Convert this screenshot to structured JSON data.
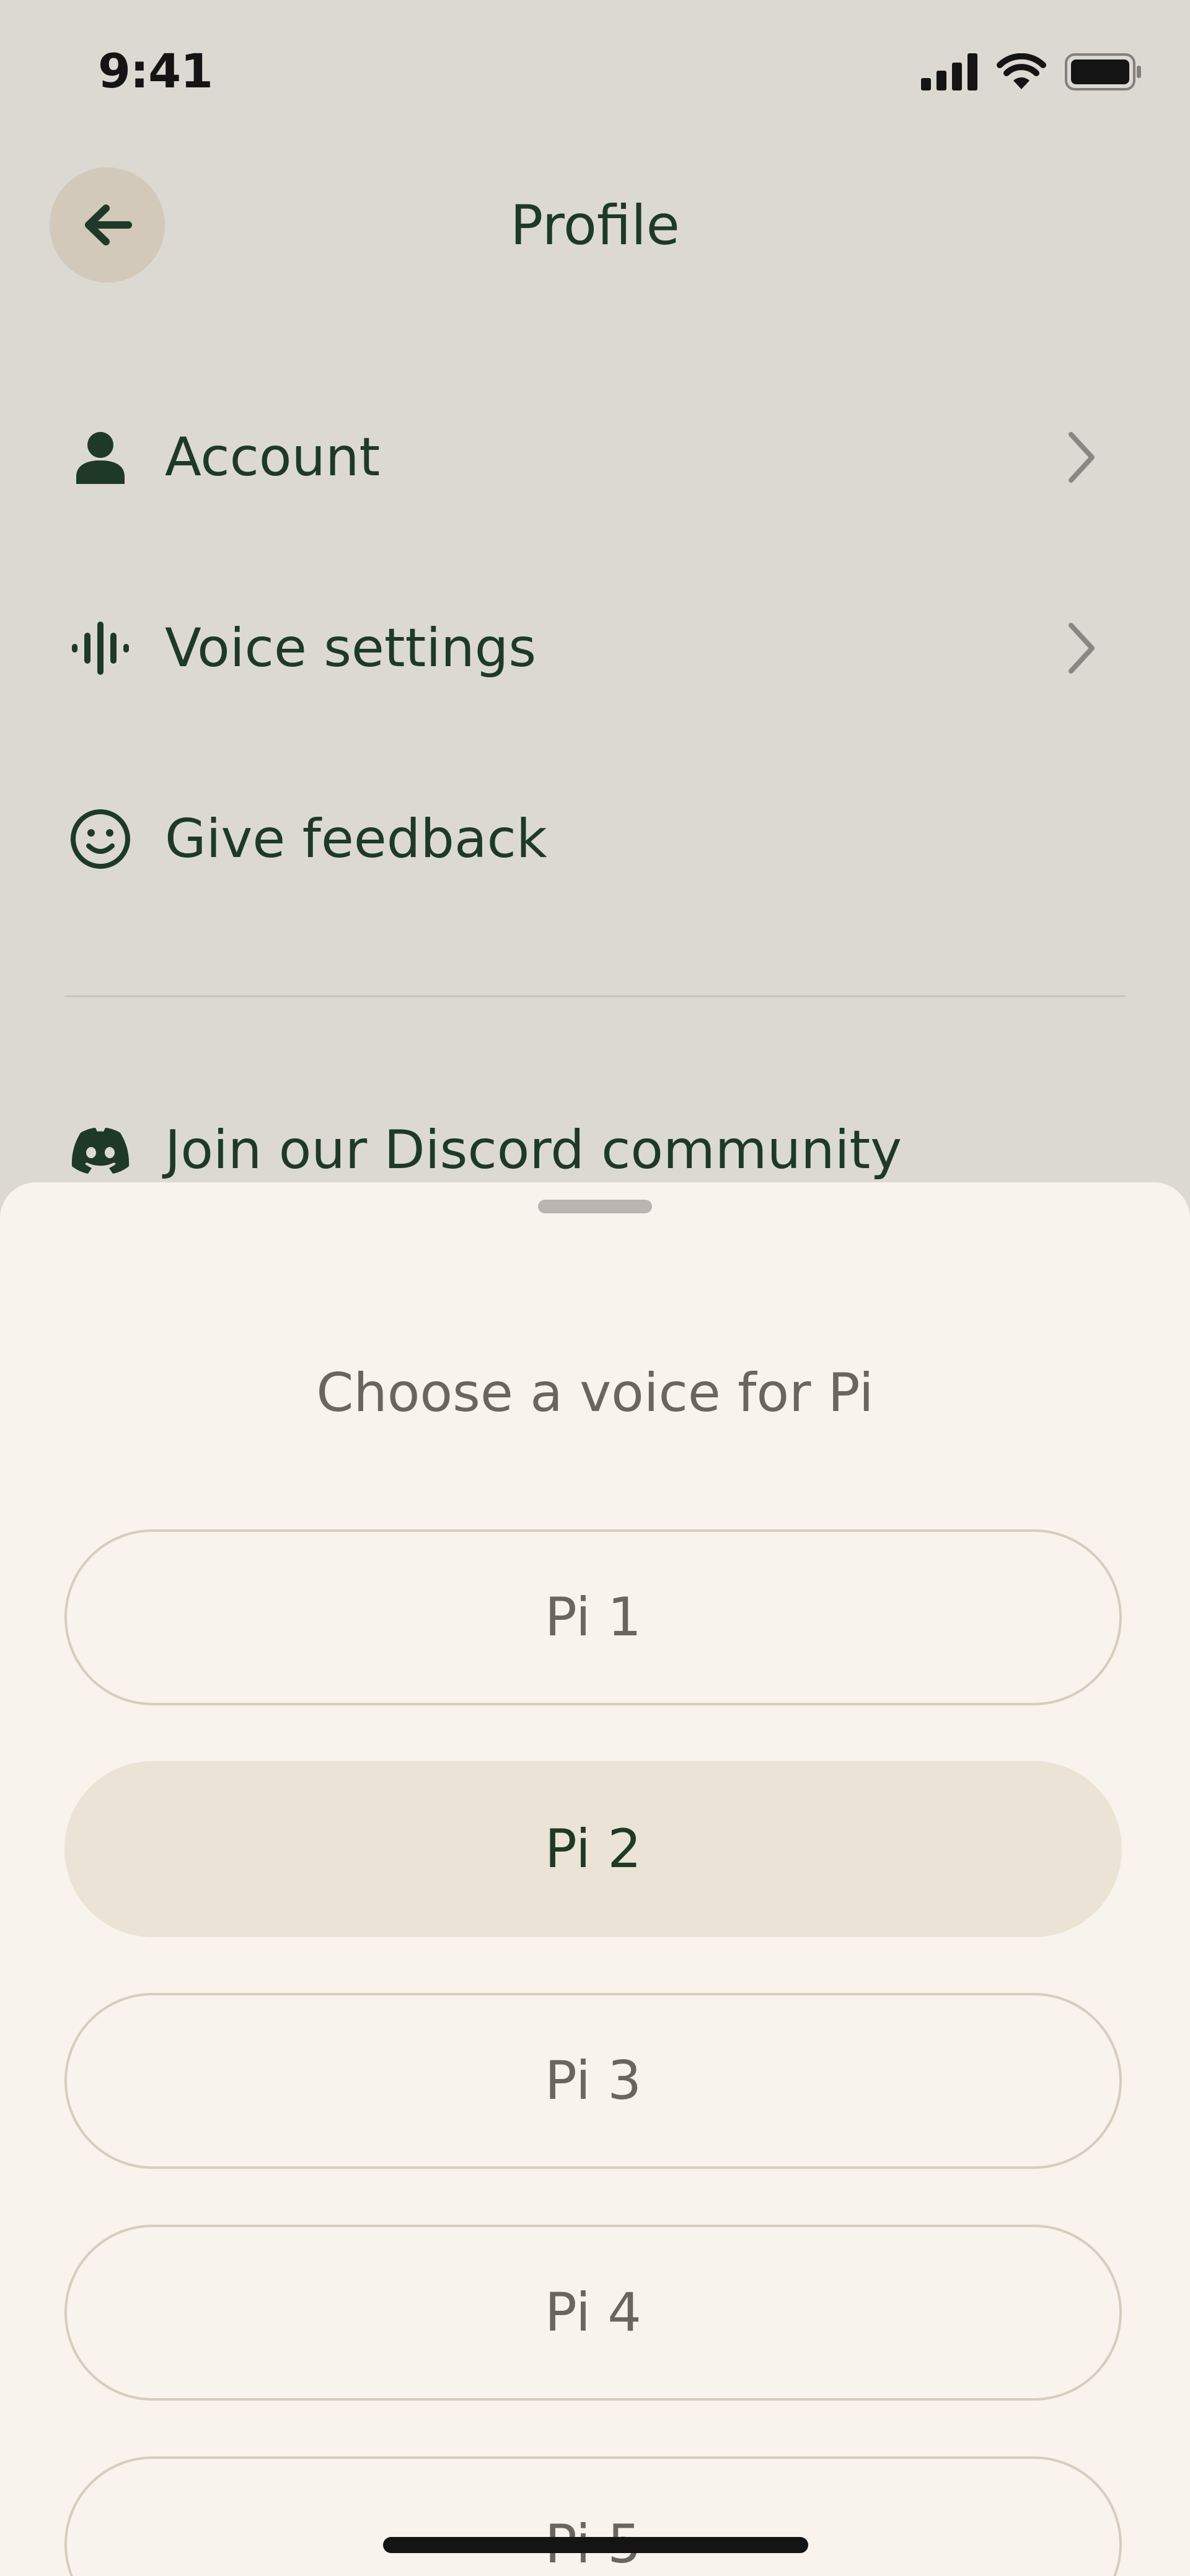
{
  "status_bar": {
    "time": "9:41",
    "icons": [
      "signal-icon",
      "wifi-icon",
      "battery-icon"
    ]
  },
  "header": {
    "title": "Profile",
    "back_icon": "arrow-left-icon"
  },
  "menu": {
    "items": [
      {
        "label": "Account",
        "icon": "person-icon",
        "has_chevron": true
      },
      {
        "label": "Voice settings",
        "icon": "waveform-icon",
        "has_chevron": true
      },
      {
        "label": "Give feedback",
        "icon": "smiley-icon",
        "has_chevron": false
      },
      {
        "label": "Join our Discord community",
        "icon": "discord-icon",
        "has_chevron": false
      }
    ]
  },
  "voice_sheet": {
    "title": "Choose a voice for Pi",
    "options": [
      "Pi 1",
      "Pi 2",
      "Pi 3",
      "Pi 4",
      "Pi 5"
    ],
    "selected": "Pi 2"
  },
  "colors": {
    "background": "#dcd9d3",
    "sheet_background": "#f8f3ec",
    "primary_text": "#1e3a26",
    "secondary_text": "#69665d",
    "selected_option": "#ebe3d6",
    "back_button_bg": "#d2c9bb"
  }
}
